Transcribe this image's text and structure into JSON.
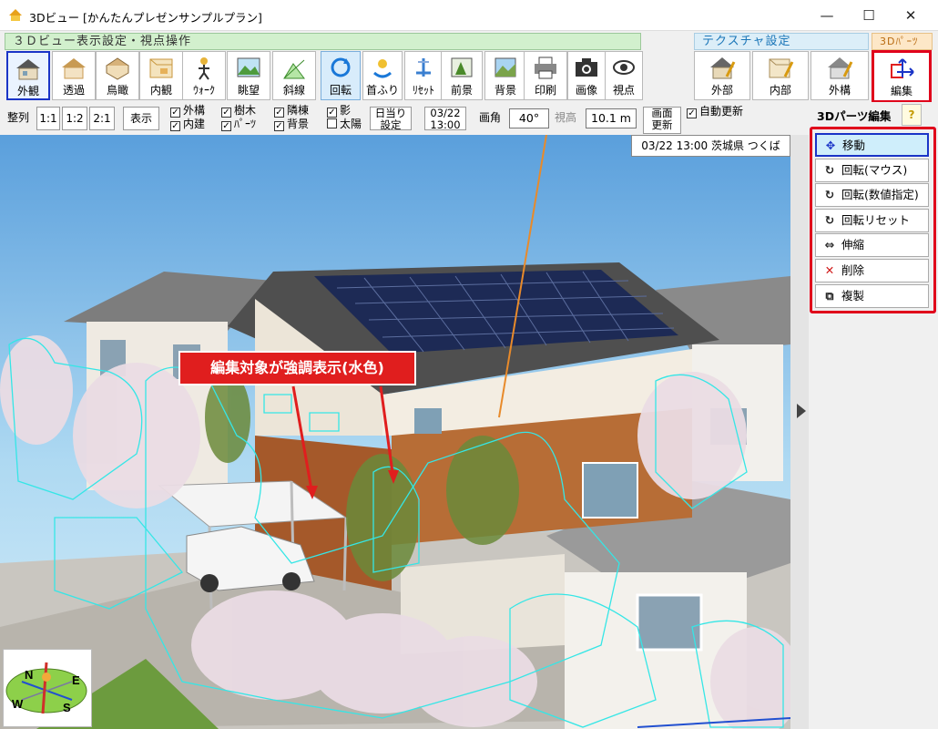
{
  "window": {
    "title": "3Dビュー [かんたんプレゼンサンプルプラン]",
    "minimize": "—",
    "maximize": "☐",
    "close": "✕"
  },
  "groups": {
    "view": "３Ｄビュー表示設定・視点操作",
    "texture": "テクスチャ設定",
    "parts": "3Dﾊﾟｰﾂ"
  },
  "toolbar": [
    {
      "label": "外観",
      "icon": "house-exterior-icon"
    },
    {
      "label": "透過",
      "icon": "house-transparent-icon"
    },
    {
      "label": "鳥瞰",
      "icon": "birds-eye-icon"
    },
    {
      "label": "内観",
      "icon": "interior-icon"
    },
    {
      "label": "ｳｫｰｸ",
      "icon": "walk-icon"
    },
    {
      "label": "眺望",
      "icon": "landscape-icon"
    },
    {
      "label": "斜線",
      "icon": "slant-line-icon"
    },
    {
      "label": "回転",
      "icon": "rotate-icon"
    },
    {
      "label": "首ふり",
      "icon": "head-turn-icon"
    },
    {
      "label": "ﾘｾｯﾄ",
      "icon": "reset-icon"
    },
    {
      "label": "前景",
      "icon": "foreground-icon"
    },
    {
      "label": "背景",
      "icon": "background-icon"
    },
    {
      "label": "印刷",
      "icon": "printer-icon"
    },
    {
      "label": "画像",
      "icon": "camera-icon"
    },
    {
      "label": "視点",
      "icon": "eye-icon"
    }
  ],
  "texture_buttons": [
    {
      "label": "外部",
      "icon": "exterior-texture-icon"
    },
    {
      "label": "内部",
      "icon": "interior-texture-icon"
    },
    {
      "label": "外構",
      "icon": "exterior-works-icon"
    }
  ],
  "parts_button": {
    "label": "編集",
    "icon": "parts-edit-icon"
  },
  "row2": {
    "align": "整列",
    "ratios": [
      "1:1",
      "1:2",
      "2:1"
    ],
    "display": "表示",
    "checks": [
      {
        "label": "外構",
        "checked": true
      },
      {
        "label": "内建",
        "checked": true
      },
      {
        "label": "樹木",
        "checked": true
      },
      {
        "label": "ﾊﾟｰﾂ",
        "checked": true
      },
      {
        "label": "隣棟",
        "checked": true
      },
      {
        "label": "背景",
        "checked": true
      },
      {
        "label": "影",
        "checked": true
      },
      {
        "label": "太陽",
        "checked": false
      }
    ],
    "sun_setting_line1": "日当り",
    "sun_setting_line2": "設定",
    "date": "03/22",
    "time": "13:00",
    "angle_label": "画角",
    "angle_value": "40°",
    "height_label": "視高",
    "height_value": "10.1 m",
    "refresh_line1": "画面",
    "refresh_line2": "更新",
    "auto_refresh": "自動更新",
    "auto_refresh_checked": true
  },
  "status": "03/22 13:00 茨城県 つくば",
  "panel": {
    "title": "3Dパーツ編集",
    "help": "?",
    "buttons": [
      {
        "label": "移動",
        "icon": "move-icon",
        "glyph": "✥",
        "color": "#1a34c7"
      },
      {
        "label": "回転(マウス)",
        "icon": "rotate-mouse-icon",
        "glyph": "↻",
        "color": "#222"
      },
      {
        "label": "回転(数値指定)",
        "icon": "rotate-numeric-icon",
        "glyph": "↻",
        "color": "#222"
      },
      {
        "label": "回転リセット",
        "icon": "rotate-reset-icon",
        "glyph": "↻",
        "color": "#222"
      },
      {
        "label": "伸縮",
        "icon": "stretch-icon",
        "glyph": "⇔",
        "color": "#222"
      },
      {
        "label": "削除",
        "icon": "delete-icon",
        "glyph": "✕",
        "color": "#d01818"
      },
      {
        "label": "複製",
        "icon": "duplicate-icon",
        "glyph": "⧉",
        "color": "#222"
      }
    ]
  },
  "annotation": "編集対象が強調表示(水色)",
  "compass": {
    "n": "N",
    "e": "E",
    "s": "S",
    "w": "W"
  },
  "colors": {
    "highlight": "#35e6e6",
    "selection": "#1a34c7",
    "callout": "#e01e1e"
  }
}
